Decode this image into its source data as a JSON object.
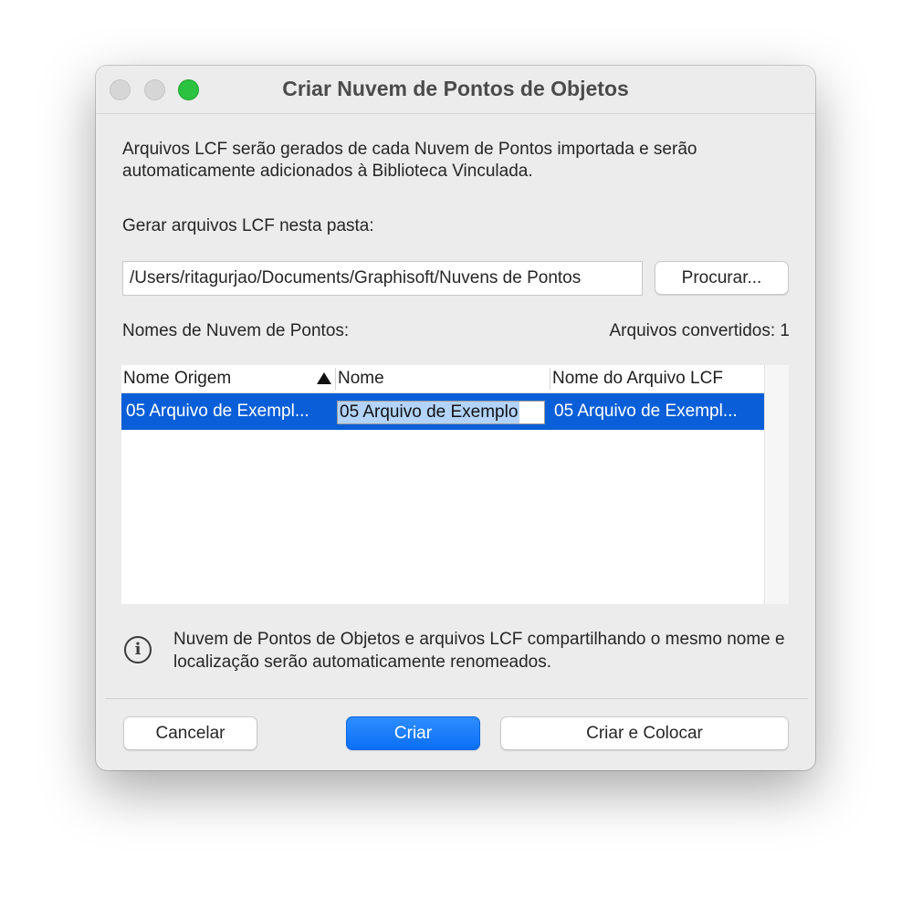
{
  "window": {
    "title": "Criar Nuvem de Pontos de Objetos"
  },
  "description": "Arquivos LCF serão gerados de cada Nuvem de Pontos importada e serão automaticamente adicionados à Biblioteca Vinculada.",
  "folder": {
    "label": "Gerar arquivos LCF nesta pasta:",
    "path": "/Users/ritagurjao/Documents/Graphisoft/Nuvens de Pontos",
    "browse_label": "Procurar..."
  },
  "list": {
    "title": "Nomes de Nuvem de Pontos:",
    "converted_count": "Arquivos convertidos: 1",
    "columns": [
      "Nome Origem",
      "Nome",
      "Nome do Arquivo LCF"
    ],
    "sort_icon": "triangle-up-icon",
    "rows": [
      {
        "source": "05 Arquivo de Exempl...",
        "name": "05 Arquivo de Exemplo",
        "lcf_file": "05 Arquivo de Exempl..."
      }
    ]
  },
  "info": {
    "icon": "info-icon",
    "text": "Nuvem de Pontos de Objetos e arquivos LCF compartilhando o mesmo nome e localização serão automaticamente renomeados."
  },
  "buttons": {
    "cancel": "Cancelar",
    "create": "Criar",
    "create_place": "Criar e Colocar"
  },
  "colors": {
    "accent": "#0a6ff5",
    "selection": "#0a5fd8",
    "zoom_button": "#2ac23f"
  }
}
